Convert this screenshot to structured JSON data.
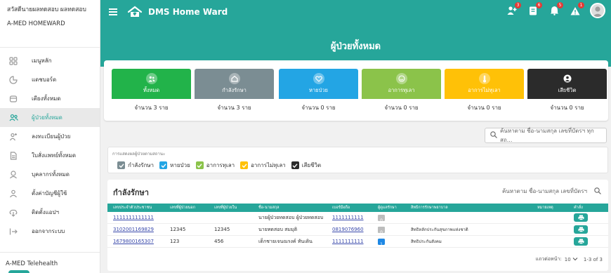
{
  "sidebar": {
    "org_name": "สวัสดีนายผลทดสอบ ผลทดสอบ",
    "org_sub": "A-MED HOMEWARD",
    "items": [
      {
        "label": "เมนูหลัก",
        "icon": "grid-icon"
      },
      {
        "label": "แดชบอร์ด",
        "icon": "dashboard-icon"
      },
      {
        "label": "เตียงทั้งหมด",
        "icon": "bed-icon"
      },
      {
        "label": "ผู้ป่วยทั้งหมด",
        "icon": "patients-icon"
      },
      {
        "label": "ลงทะเบียนผู้ป่วย",
        "icon": "add-user-icon"
      },
      {
        "label": "ใบสั่งแพทย์ทั้งหมด",
        "icon": "document-icon"
      },
      {
        "label": "บุคลากรทั้งหมด",
        "icon": "staff-icon"
      },
      {
        "label": "ตั้งค่าบัญชีผู้ใช้",
        "icon": "user-settings-icon"
      },
      {
        "label": "ติดตั้งแอปฯ",
        "icon": "install-icon"
      },
      {
        "label": "ออกจากระบบ",
        "icon": "logout-icon"
      }
    ],
    "active_index": 3,
    "footer": "A-MED Telehealth"
  },
  "header": {
    "app_name": "DMS Home Ward",
    "icons": [
      {
        "name": "user-plus-icon",
        "badge": "3"
      },
      {
        "name": "clipboard-icon",
        "badge": "6"
      },
      {
        "name": "bell-icon",
        "badge": "5"
      },
      {
        "name": "alert-icon",
        "badge": "1"
      }
    ]
  },
  "page": {
    "title": "ผู้ป่วยทั้งหมด"
  },
  "status_cards": [
    {
      "label": "ทั้งหมด",
      "count": "จำนวน 3 ราย",
      "color": "#22b34a",
      "icon": "people-icon"
    },
    {
      "label": "กำลังรักษา",
      "count": "จำนวน 3 ราย",
      "color": "#7b8d93",
      "icon": "home-icon"
    },
    {
      "label": "หายป่วย",
      "count": "จำนวน 0 ราย",
      "color": "#23a5e4",
      "icon": "heart-icon"
    },
    {
      "label": "อาการทุเลา",
      "count": "จำนวน 0 ราย",
      "color": "#8bc34a",
      "icon": "smile-icon"
    },
    {
      "label": "อาการไม่ทุเลา",
      "count": "จำนวน 0 ราย",
      "color": "#ffc107",
      "icon": "thermometer-icon"
    },
    {
      "label": "เสียชีวิต",
      "count": "จำนวน 0 ราย",
      "color": "#2b2b2b",
      "icon": "deceased-icon"
    }
  ],
  "search": {
    "placeholder": "ค้นหาตาม ชื่อ-นามสกุล เลขที่บัตรฯ ทุกสถ..."
  },
  "filter": {
    "title": "การแสดงผลผู้ป่วยตามสถานะ",
    "options": [
      {
        "label": "กำลังรักษา",
        "color": "#7b8d93",
        "checked": true
      },
      {
        "label": "หายป่วย",
        "color": "#23a5e4",
        "checked": true
      },
      {
        "label": "อาการทุเลา",
        "color": "#8bc34a",
        "checked": true
      },
      {
        "label": "อาการไม่ทุเลา",
        "color": "#ffc107",
        "checked": true
      },
      {
        "label": "เสียชีวิต",
        "color": "#2b2b2b",
        "checked": true
      }
    ]
  },
  "table": {
    "title": "กำลังรักษา",
    "search_placeholder": "ค้นหาตาม ชื่อ-นามสกุล เลขที่บัตรฯ",
    "columns": [
      "เลขประจำตัวประชาชน",
      "เลขที่ผู้ป่วยนอก",
      "เลขที่ผู้ป่วยใน",
      "ชื่อ-นามสกุล",
      "เบอร์มือถือ",
      "ผู้ดูแลรักษา",
      "สิทธิการรักษาพยาบาล",
      "หมายเหตุ",
      "คำสั่ง"
    ],
    "rows": [
      {
        "id": "1111111111111",
        "hn": "",
        "an": "",
        "name": "นายผู้ป่วยทดสอบ ผู้ป่วยทดสอบ",
        "phone": "1111111111",
        "care": [
          "0",
          "0",
          "0"
        ],
        "care_colors": [
          "#bdbdbd",
          "#bdbdbd",
          "#bdbdbd"
        ],
        "right": "",
        "note": ""
      },
      {
        "id": "3102001169829",
        "hn": "12345",
        "an": "12345",
        "name": "นายทดสอบ สมมุติ",
        "phone": "0819076960",
        "care": [
          "1",
          "0",
          "0"
        ],
        "care_colors": [
          "#22b34a",
          "#bdbdbd",
          "#bdbdbd"
        ],
        "right": "สิทธิหลักประกันสุขภาพแห่งชาติ",
        "note": ""
      },
      {
        "id": "1679800165307",
        "hn": "123",
        "an": "456",
        "name": "เด็กชายเจนณรงค์ ทันเดิน",
        "phone": "1111111111",
        "care": [
          "1",
          "0",
          "1"
        ],
        "care_colors": [
          "#22b34a",
          "#bdbdbd",
          "#1e88e5"
        ],
        "right": "สิทธิประกันสังคม",
        "note": ""
      }
    ],
    "rows_per_page_label": "แถวต่อหน้า:",
    "rows_per_page": "10",
    "range": "1-3 of 3"
  }
}
